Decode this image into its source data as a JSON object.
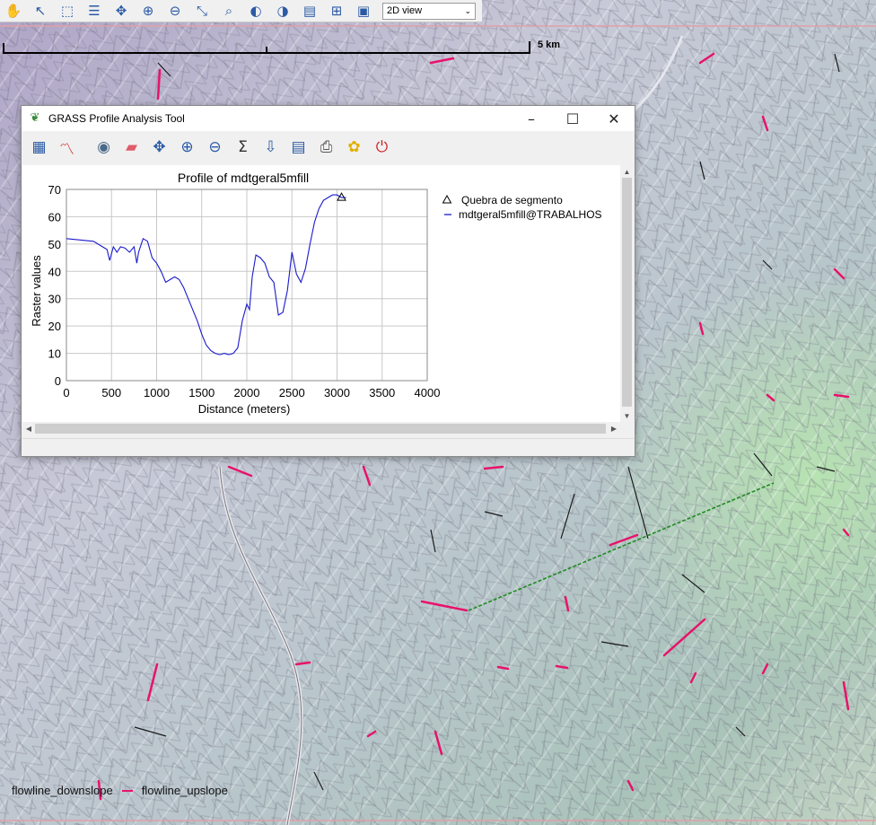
{
  "toolbar": {
    "icons": [
      "pan-icon",
      "pointer-icon",
      "select-icon",
      "query-icon",
      "zoom-extent-icon",
      "zoom-in-icon",
      "zoom-out-icon",
      "zoom-back-icon",
      "zoom-region-icon",
      "zoom-prev-icon",
      "zoom-next-icon",
      "analyze-icon",
      "decorations-icon",
      "overlay-icon"
    ],
    "view_mode": "2D view"
  },
  "map": {
    "scale_label": "5 km",
    "legend": [
      {
        "label": "flowline_downslope"
      },
      {
        "label": "flowline_upslope",
        "color": "#e8126b"
      }
    ],
    "profile_line_color": "#1f8a1f",
    "flowline_color": "#e8126b"
  },
  "window": {
    "title": "GRASS Profile Analysis Tool",
    "controls": {
      "minimize": "–",
      "maximize": "☐",
      "close": "✕"
    },
    "tools": [
      "add-raster-icon",
      "draw-profile-icon",
      "options-icon",
      "erase-icon",
      "pan-icon",
      "zoom-in-icon",
      "zoom-out-icon",
      "statistics-icon",
      "save-icon",
      "export-icon",
      "print-icon",
      "settings-icon",
      "quit-icon"
    ]
  },
  "chart_data": {
    "type": "line",
    "title": "Profile of mdtgeral5mfill",
    "xlabel": "Distance (meters)",
    "ylabel": "Raster values",
    "xlim": [
      0,
      4000
    ],
    "ylim": [
      0,
      70
    ],
    "x_ticks": [
      0,
      500,
      1000,
      1500,
      2000,
      2500,
      3000,
      3500,
      4000
    ],
    "y_ticks": [
      0,
      10,
      20,
      30,
      40,
      50,
      60,
      70
    ],
    "grid": true,
    "legend_position": "right",
    "series": [
      {
        "name": "mdtgeral5mfill@TRABALHOS",
        "color": "#1a1acc",
        "x": [
          0,
          150,
          300,
          400,
          450,
          480,
          520,
          560,
          600,
          650,
          700,
          750,
          780,
          800,
          850,
          900,
          950,
          1000,
          1050,
          1100,
          1150,
          1200,
          1250,
          1300,
          1350,
          1400,
          1450,
          1500,
          1550,
          1600,
          1650,
          1700,
          1750,
          1800,
          1850,
          1900,
          1950,
          2000,
          2030,
          2060,
          2100,
          2150,
          2200,
          2250,
          2300,
          2350,
          2400,
          2450,
          2500,
          2550,
          2600,
          2650,
          2700,
          2750,
          2800,
          2850,
          2900,
          2950,
          3000,
          3050,
          3100
        ],
        "y": [
          52,
          51.5,
          51,
          49,
          48,
          44,
          49,
          47,
          49,
          48.5,
          47,
          49,
          43,
          47,
          52,
          51,
          45,
          43,
          40,
          36,
          37,
          38,
          37,
          34,
          30,
          26,
          22,
          17,
          13,
          11,
          10,
          9.5,
          10,
          9.5,
          10,
          12,
          22,
          28,
          26,
          38,
          46,
          45,
          43,
          38,
          36,
          24,
          25,
          33,
          47,
          39,
          36,
          41,
          50,
          58,
          63,
          66,
          67,
          68,
          68,
          67,
          67
        ]
      },
      {
        "name": "Quebra de segmento",
        "marker": "triangle",
        "x": [
          3050
        ],
        "y": [
          67
        ]
      }
    ]
  }
}
